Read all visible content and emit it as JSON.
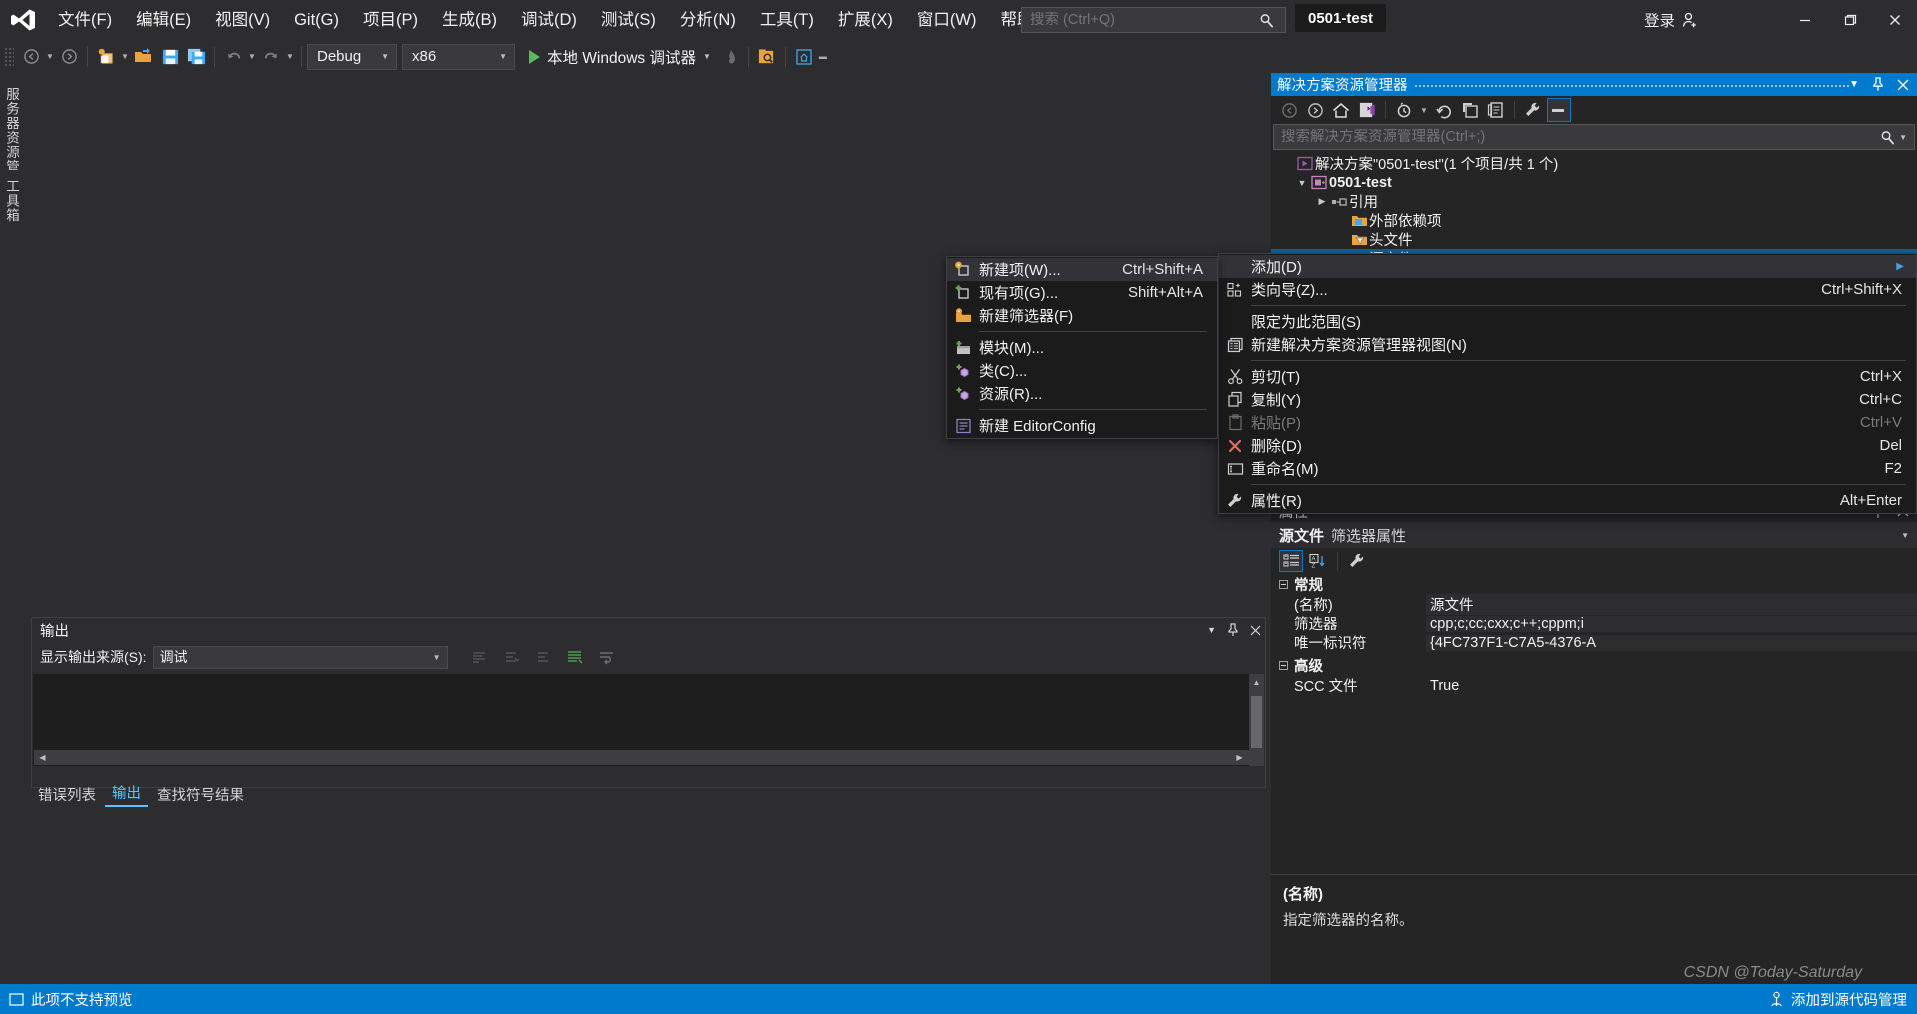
{
  "window": {
    "project_chip": "0501-test",
    "signin_label": "登录",
    "search_placeholder": "搜索 (Ctrl+Q)",
    "live_share": "Live Share",
    "minimize": "minimize-icon",
    "restore": "restore-icon",
    "close": "close-icon"
  },
  "menubar": {
    "items": [
      {
        "label": "文件(F)"
      },
      {
        "label": "编辑(E)"
      },
      {
        "label": "视图(V)"
      },
      {
        "label": "Git(G)"
      },
      {
        "label": "项目(P)"
      },
      {
        "label": "生成(B)"
      },
      {
        "label": "调试(D)"
      },
      {
        "label": "测试(S)"
      },
      {
        "label": "分析(N)"
      },
      {
        "label": "工具(T)"
      },
      {
        "label": "扩展(X)"
      },
      {
        "label": "窗口(W)"
      },
      {
        "label": "帮助(H)"
      }
    ]
  },
  "toolbar": {
    "config": "Debug",
    "platform": "x86",
    "run_label": "本地 Windows 调试器"
  },
  "left_tabs": [
    {
      "label": "服务器资源管理器"
    },
    {
      "label": "工具箱"
    }
  ],
  "solution_explorer": {
    "title": "解决方案资源管理器",
    "search_placeholder": "搜索解决方案资源管理器(Ctrl+;)",
    "tree": [
      {
        "label": "解决方案\"0501-test\"(1 个项目/共 1 个)",
        "indent": 0,
        "icon": "solution-icon",
        "expander": "",
        "bold": false,
        "selected": false
      },
      {
        "label": "0501-test",
        "indent": 1,
        "icon": "project-icon",
        "expander": "▲",
        "bold": true,
        "selected": false
      },
      {
        "label": "引用",
        "indent": 2,
        "icon": "references-icon",
        "expander": "▶",
        "bold": false,
        "selected": false
      },
      {
        "label": "外部依赖项",
        "indent": 3,
        "icon": "folder-blue-icon",
        "expander": "",
        "bold": false,
        "selected": false
      },
      {
        "label": "头文件",
        "indent": 3,
        "icon": "filter-icon",
        "expander": "",
        "bold": false,
        "selected": false
      },
      {
        "label": "源文件",
        "indent": 3,
        "icon": "filter-icon",
        "expander": "",
        "bold": false,
        "selected": true
      }
    ]
  },
  "properties": {
    "title": "属性",
    "object_name": "源文件",
    "object_type": "筛选器属性",
    "categories": [
      {
        "name": "常规",
        "rows": [
          {
            "key": "(名称)",
            "value": "源文件",
            "shaded": true
          },
          {
            "key": "筛选器",
            "value": "cpp;c;cc;cxx;c++;cppm;i",
            "shaded": true
          },
          {
            "key": "唯一标识符",
            "value": "{4FC737F1-C7A5-4376-A",
            "shaded": true
          }
        ]
      },
      {
        "name": "高级",
        "rows": [
          {
            "key": "SCC 文件",
            "value": "True",
            "shaded": false
          }
        ]
      }
    ],
    "description_title": "(名称)",
    "description_body": "指定筛选器的名称。"
  },
  "output_panel": {
    "title": "输出",
    "source_label": "显示输出来源(S):",
    "source_value": "调试"
  },
  "bottom_tabs": [
    {
      "label": "错误列表",
      "active": false
    },
    {
      "label": "输出",
      "active": true
    },
    {
      "label": "查找符号结果",
      "active": false
    }
  ],
  "statusbar": {
    "left_text": "此项不支持预览",
    "right_text": "添加到源代码管理"
  },
  "watermark": "CSDN @Today-Saturday",
  "context_menu": {
    "items": [
      {
        "label": "添加(D)",
        "shortcut": "",
        "icon": "",
        "submenu": true,
        "highlight": true,
        "disabled": false,
        "sep_after": false
      },
      {
        "label": "类向导(Z)...",
        "shortcut": "Ctrl+Shift+X",
        "icon": "class-wizard-icon",
        "submenu": false,
        "highlight": false,
        "disabled": false,
        "sep_after": true
      },
      {
        "label": "限定为此范围(S)",
        "shortcut": "",
        "icon": "",
        "submenu": false,
        "highlight": false,
        "disabled": false,
        "sep_after": false
      },
      {
        "label": "新建解决方案资源管理器视图(N)",
        "shortcut": "",
        "icon": "new-view-icon",
        "submenu": false,
        "highlight": false,
        "disabled": false,
        "sep_after": true
      },
      {
        "label": "剪切(T)",
        "shortcut": "Ctrl+X",
        "icon": "scissors-icon",
        "submenu": false,
        "highlight": false,
        "disabled": false,
        "sep_after": false
      },
      {
        "label": "复制(Y)",
        "shortcut": "Ctrl+C",
        "icon": "copy-icon",
        "submenu": false,
        "highlight": false,
        "disabled": false,
        "sep_after": false
      },
      {
        "label": "粘贴(P)",
        "shortcut": "Ctrl+V",
        "icon": "paste-icon",
        "submenu": false,
        "highlight": false,
        "disabled": true,
        "sep_after": false
      },
      {
        "label": "删除(D)",
        "shortcut": "Del",
        "icon": "delete-x-icon",
        "submenu": false,
        "highlight": false,
        "disabled": false,
        "sep_after": false
      },
      {
        "label": "重命名(M)",
        "shortcut": "F2",
        "icon": "rename-icon",
        "submenu": false,
        "highlight": false,
        "disabled": false,
        "sep_after": true
      },
      {
        "label": "属性(R)",
        "shortcut": "Alt+Enter",
        "icon": "wrench-icon",
        "submenu": false,
        "highlight": false,
        "disabled": false,
        "sep_after": false
      }
    ]
  },
  "add_submenu": {
    "items": [
      {
        "label": "新建项(W)...",
        "shortcut": "Ctrl+Shift+A",
        "icon": "new-item-icon",
        "highlight": true,
        "sep_after": false
      },
      {
        "label": "现有项(G)...",
        "shortcut": "Shift+Alt+A",
        "icon": "existing-item-icon",
        "highlight": false,
        "sep_after": false
      },
      {
        "label": "新建筛选器(F)",
        "shortcut": "",
        "icon": "new-filter-icon",
        "highlight": false,
        "sep_after": true
      },
      {
        "label": "模块(M)...",
        "shortcut": "",
        "icon": "module-icon",
        "highlight": false,
        "sep_after": false
      },
      {
        "label": "类(C)...",
        "shortcut": "",
        "icon": "class-icon",
        "highlight": false,
        "sep_after": false
      },
      {
        "label": "资源(R)...",
        "shortcut": "",
        "icon": "resource-icon",
        "highlight": false,
        "sep_after": true
      },
      {
        "label": "新建 EditorConfig",
        "shortcut": "",
        "icon": "editorconfig-icon",
        "highlight": false,
        "sep_after": false
      }
    ]
  },
  "colors": {
    "accent": "#007acc",
    "window_bg": "#2d2d30",
    "panel_bg": "#252526",
    "editor_bg": "#1e1e1e",
    "menu_bg": "#1b1b1c",
    "selection": "#0e639c"
  }
}
